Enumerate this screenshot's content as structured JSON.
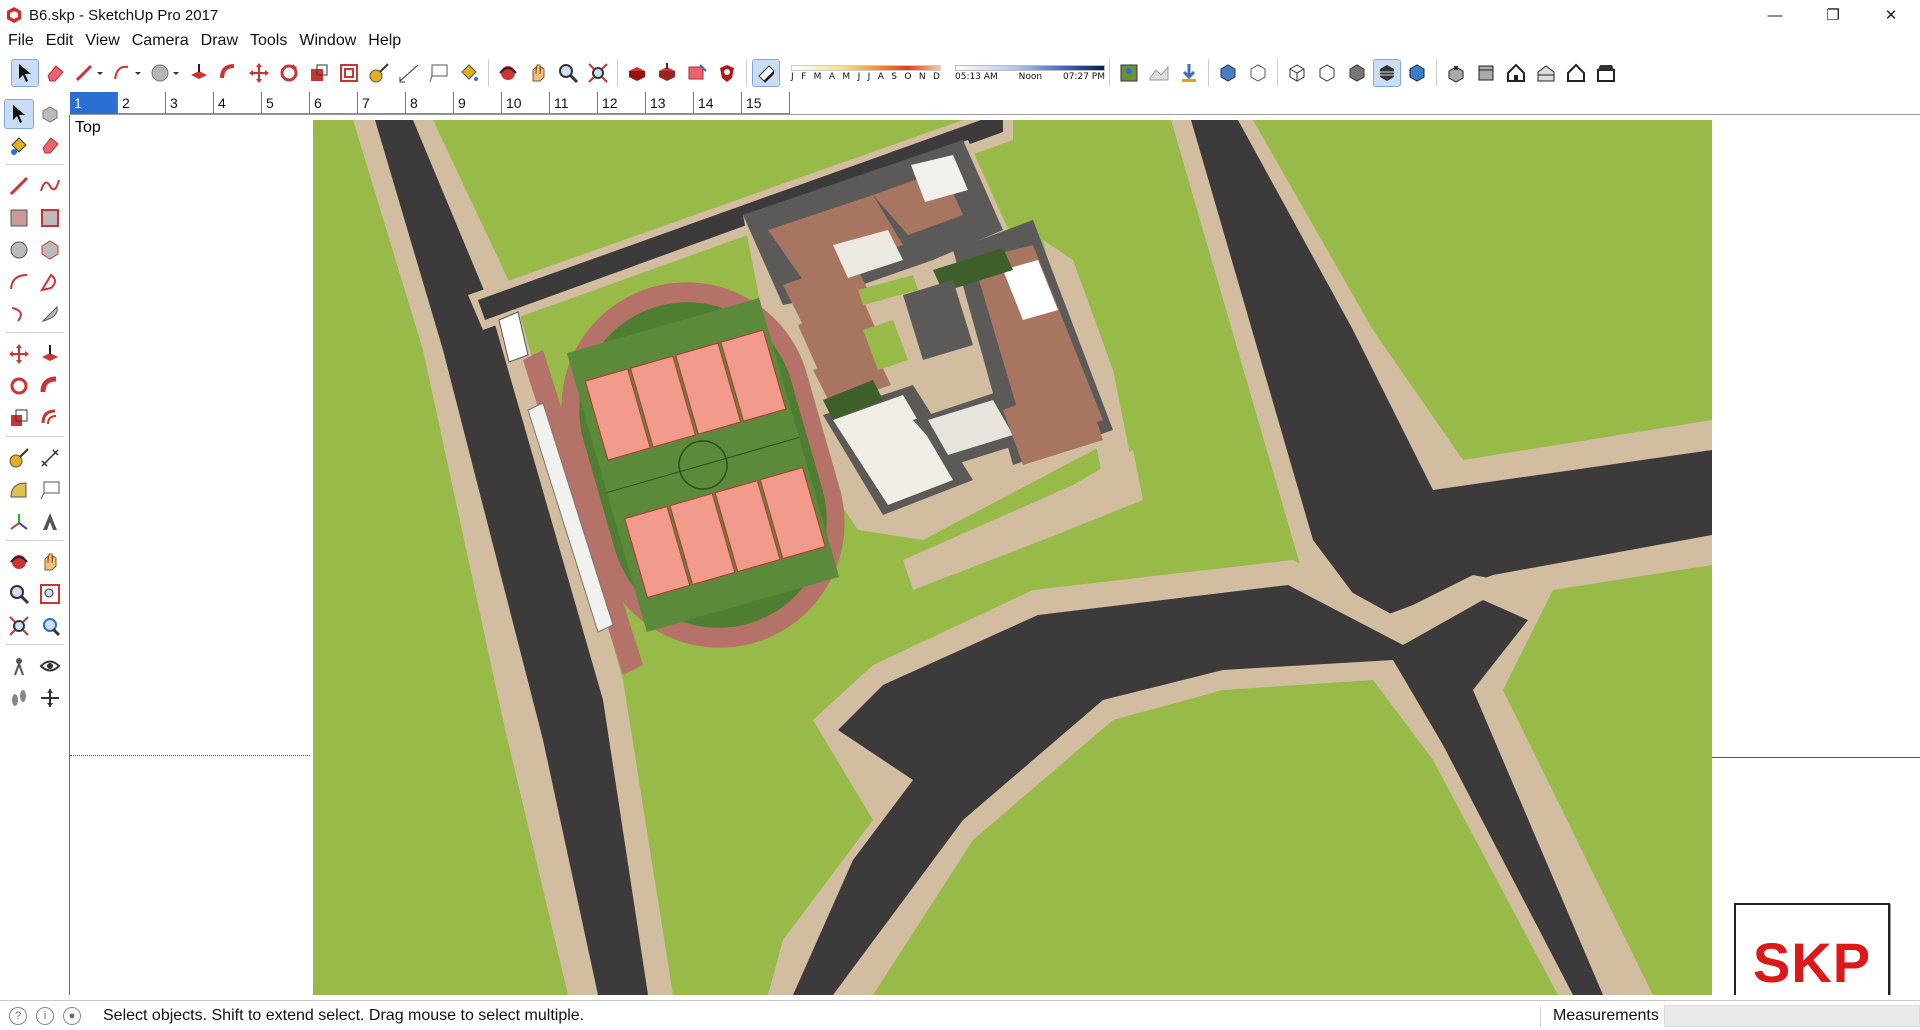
{
  "window": {
    "title": "B6.skp - SketchUp Pro 2017",
    "minimize": "—",
    "restore": "❐",
    "close": "✕"
  },
  "menu": [
    "File",
    "Edit",
    "View",
    "Camera",
    "Draw",
    "Tools",
    "Window",
    "Help"
  ],
  "shadow": {
    "months": [
      "J",
      "F",
      "M",
      "A",
      "M",
      "J",
      "J",
      "A",
      "S",
      "O",
      "N",
      "D"
    ],
    "time_start": "05:13 AM",
    "time_mid": "Noon",
    "time_end": "07:27 PM"
  },
  "scenes": [
    "1",
    "2",
    "3",
    "4",
    "5",
    "6",
    "7",
    "8",
    "9",
    "10",
    "11",
    "12",
    "13",
    "14",
    "15"
  ],
  "viewport": {
    "camera_label": "Top"
  },
  "logo": {
    "text": "SKP"
  },
  "status": {
    "message": "Select objects. Shift to extend select. Drag mouse to select multiple.",
    "measurements_label": "Measurements",
    "measurements_value": ""
  },
  "colors": {
    "grass": "#97ba48",
    "road": "#3d3a3c",
    "sidewalk": "#d2bda0",
    "track": "#b57268",
    "field": "#4f7d32",
    "court": "#f29a8c",
    "roof": "#a87560",
    "accent": "#2a6fd2"
  }
}
